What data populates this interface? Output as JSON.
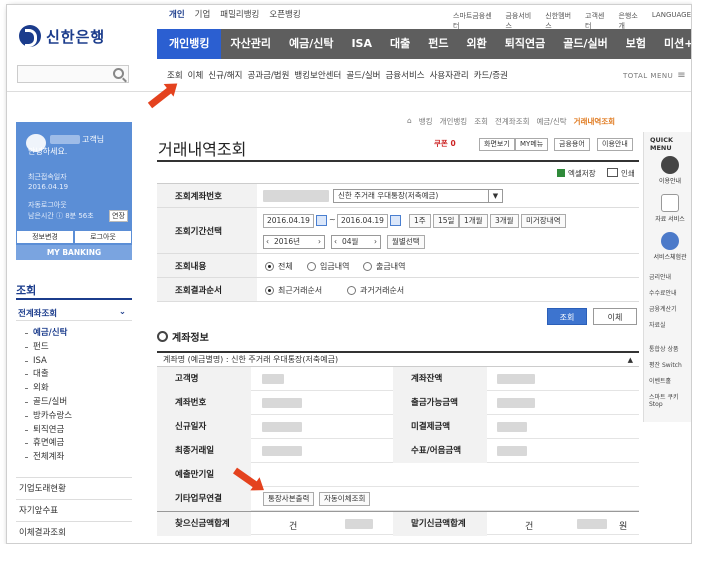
{
  "header": {
    "logo_text": "신한은행",
    "top_nav": [
      "개인",
      "기업",
      "패밀리뱅킹",
      "오픈뱅킹"
    ],
    "util_nav": [
      "스마트금융센터",
      "금융서비스",
      "신한멤버스",
      "고객센터",
      "은행소개",
      "LANGUAGE"
    ],
    "main_menu": [
      "개인뱅킹",
      "자산관리",
      "예금/신탁",
      "ISA",
      "대출",
      "펀드",
      "외환",
      "퇴직연금",
      "골드/실버",
      "보험",
      "미션+"
    ],
    "sub_menu": [
      "조회",
      "이체",
      "신규/해지",
      "공과금/법원",
      "뱅킹보안센터",
      "골드/실버",
      "금융서비스",
      "사용자관리",
      "카드/증권"
    ],
    "total_menu": "TOTAL MENU"
  },
  "left": {
    "greeting_suffix": "고객님",
    "greeting": "안녕하세요.",
    "last_login_label": "최근접속일자",
    "last_login_date": "2016.04.19",
    "auto_logout": "자동로그아웃",
    "remaining": "남은시간 ⓘ 8분 56초",
    "extend": "연장",
    "btn_info": "정보변경",
    "btn_logout": "로그아웃",
    "my_banking": "MY BANKING",
    "section": "조회",
    "group": "전계좌조회",
    "items": [
      "예금/신탁",
      "펀드",
      "ISA",
      "대출",
      "외화",
      "골드/실버",
      "방카슈랑스",
      "퇴직연금",
      "휴면예금",
      "전체계좌"
    ],
    "other1": "기업도래현황",
    "other2": "자기앞수표",
    "other3": "이체결과조회"
  },
  "main": {
    "breadcrumb": [
      "뱅킹",
      "개인뱅킹",
      "조회",
      "전계좌조회",
      "예금/신탁",
      "거래내역조회"
    ],
    "title": "거래내역조회",
    "coupon": "쿠폰",
    "coupon_count": "0",
    "tool_buttons": [
      "화면보기",
      "MY메뉴",
      "금융용어",
      "이용안내"
    ],
    "excel": "엑셀저장",
    "print": "인쇄",
    "form": {
      "account_label": "조회계좌번호",
      "account_select": "신한 주거래 우대통장(저축예금)",
      "period_label": "조회기간선택",
      "date_from": "2016.04.19",
      "tilde": "~",
      "date_to": "2016.04.19",
      "quick_periods": [
        "1주",
        "15일",
        "1개월",
        "3개월",
        "미거장내역"
      ],
      "year": "2016년",
      "month": "04월",
      "month_select": "월별선택",
      "content_label": "조회내용",
      "content_options": [
        "전체",
        "입금내역",
        "출금내역"
      ],
      "order_label": "조회결과순서",
      "order_options": [
        "최근거래순서",
        "과거거래순서"
      ]
    },
    "btn_inquiry": "조회",
    "btn_transfer": "이체",
    "account_info_title": "계좌정보",
    "account_name_label": "계좌명 (예금별명) : 신한 주거래 우대통장(저축예금)",
    "info": {
      "holder": "고객명",
      "balance": "계좌잔액",
      "acct_no": "계좌번호",
      "withdrawable": "출금가능금액",
      "opened": "신규일자",
      "uncollected": "미결제금액",
      "last_tx": "최종거래일",
      "check": "수표/어음금액",
      "maturity": "예출만기일",
      "other": "기타업무연결",
      "link1": "통장사본출력",
      "link2": "자동이체조회",
      "total_in": "찾으신금액합계",
      "unit_count": "건",
      "total_in2": "맡기신금액합계",
      "unit_won": "원"
    }
  },
  "quick": {
    "title": "QUICK MENU",
    "items": [
      "이용안내",
      "자료 서비스",
      "서비스체험관"
    ],
    "list": [
      "금리안내",
      "수수료안내",
      "금융계산기",
      "자료실"
    ],
    "extra": [
      "통합상 상품",
      "평잔 Switch",
      "이벤트홀",
      "스마트 쿠키 Stop"
    ]
  }
}
